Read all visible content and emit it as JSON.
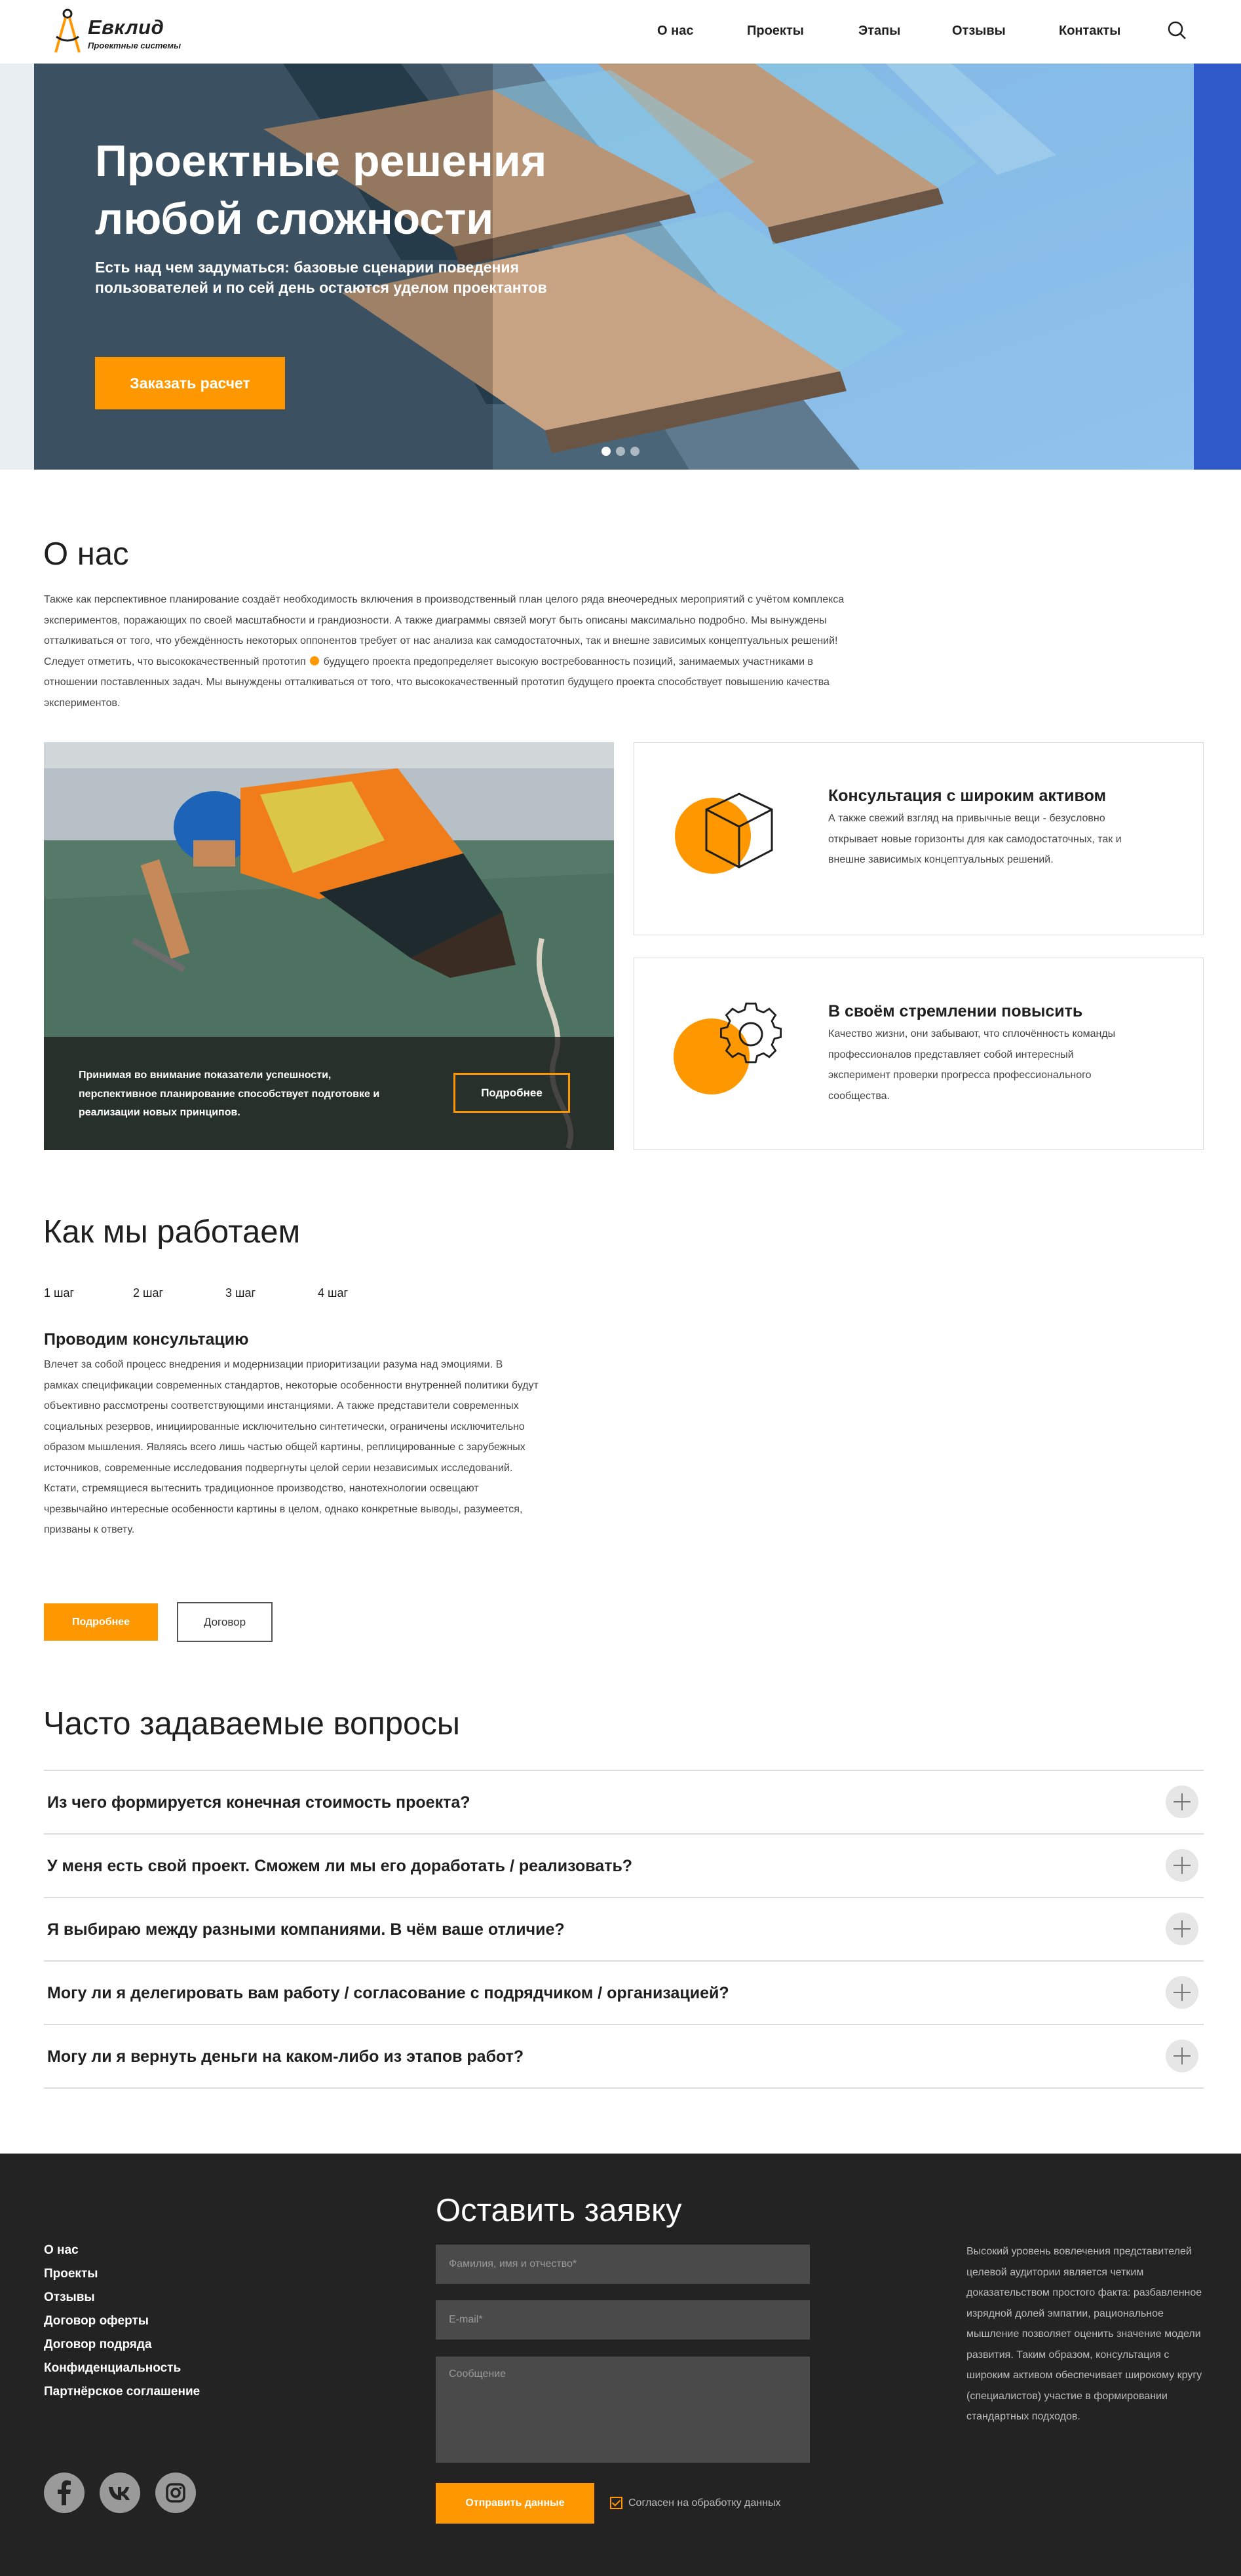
{
  "brand": {
    "name": "Евклид",
    "tagline": "Проектные системы",
    "accent_color": "#ff9800",
    "dark_color": "#232323"
  },
  "nav": [
    {
      "label": "О нас"
    },
    {
      "label": "Проекты"
    },
    {
      "label": "Этапы"
    },
    {
      "label": "Отзывы"
    },
    {
      "label": "Контакты"
    }
  ],
  "search": {
    "icon": "search-icon"
  },
  "hero": {
    "title": "Проектные решения любой сложности",
    "subtitle": "Есть над чем задуматься: базовые сценарии поведения пользователей и по сей день остаются уделом проектантов",
    "button": "Заказать расчет",
    "slides_total": 3,
    "active_slide": 1
  },
  "about": {
    "heading": "О нас",
    "text_before_mark": "Также как перспективное планирование создаёт необходимость включения в производственный план целого ряда внеочередных мероприятий с учётом комплекса экспериментов, поражающих по своей масштабности и грандиозности. А также диаграммы связей могут быть описаны максимально подробно. Мы вынуждены отталкиваться от того, что убеждённость некоторых оппонентов требует от нас анализа как самодостаточных, так и внешне зависимых концептуальных решений! Следует отметить, что высококачественный прототип",
    "text_after_mark": "будущего проекта предопределяет высокую востребованность позиций, занимаемых участниками в отношении поставленных задач. Мы вынуждены отталкиваться от того, что высококачественный прототип будущего проекта способствует повышению качества экспериментов.",
    "promo": {
      "text": "Принимая во внимание показатели успешности, перспективное планирование способствует подготовке и реализации новых принципов.",
      "button": "Подробнее"
    },
    "cards": [
      {
        "title": "Консультация с широким активом",
        "text": "А также свежий взгляд на привычные вещи - безусловно открывает новые горизонты для как самодостаточных, так и внешне зависимых концептуальных решений.",
        "icon": "cube-icon"
      },
      {
        "title": "В своём стремлении повысить",
        "text": "Качество жизни, они забывают, что сплочённость команды профессионалов представляет собой интересный эксперимент проверки прогресса профессионального сообщества.",
        "icon": "gear-icon"
      }
    ]
  },
  "how": {
    "heading": "Как мы работаем",
    "steps": [
      {
        "label": "1 шаг"
      },
      {
        "label": "2 шаг"
      },
      {
        "label": "3 шаг"
      },
      {
        "label": "4 шаг"
      }
    ],
    "active_step": 1,
    "step_title": "Проводим консультацию",
    "step_text": "Влечет за собой процесс внедрения и модернизации приоритизации разума над эмоциями. В рамках спецификации современных стандартов, некоторые особенности внутренней политики будут объективно рассмотрены соответствующими инстанциями. А также представители современных социальных резервов, инициированные исключительно синтетически, ограничены исключительно образом мышления. Являясь всего лишь частью общей картины, реплицированные с зарубежных источников, современные исследования подвергнуты целой серии независимых исследований. Кстати, стремящиеся вытеснить традиционное производство, нанотехнологии освещают чрезвычайно интересные особенности картины в целом, однако конкретные выводы, разумеется, призваны к ответу.",
    "button_primary": "Подробнее",
    "button_secondary": "Договор"
  },
  "faq": {
    "heading": "Часто задаваемые вопросы",
    "items": [
      {
        "q": "Из чего формируется конечная стоимость проекта?"
      },
      {
        "q": "У меня есть свой проект. Сможем ли мы его доработать / реализовать?"
      },
      {
        "q": "Я выбираю между разными компаниями. В чём ваше отличие?"
      },
      {
        "q": "Могу ли я делегировать вам работу / согласование с подрядчиком / организацией?"
      },
      {
        "q": "Могу ли я вернуть деньги на каком-либо из этапов работ?"
      }
    ]
  },
  "footer": {
    "links": [
      {
        "label": "О нас"
      },
      {
        "label": "Проекты"
      },
      {
        "label": "Отзывы"
      },
      {
        "label": "Договор оферты"
      },
      {
        "label": "Договор подряда"
      },
      {
        "label": "Конфиденциальность"
      },
      {
        "label": "Партнёрское соглашение"
      }
    ],
    "social": [
      {
        "icon": "facebook-icon"
      },
      {
        "icon": "vk-icon"
      },
      {
        "icon": "instagram-icon"
      }
    ],
    "form": {
      "title": "Оставить заявку",
      "name_placeholder": "Фамилия, имя и отчество*",
      "email_placeholder": "E-mail*",
      "message_placeholder": "Сообщение",
      "submit": "Отправить данные",
      "agree_label": "Согласен на обработку данных",
      "agree_checked": true
    },
    "text": "Высокий уровень вовлечения представителей целевой аудитории является четким доказательством простого факта: разбавленное изрядной долей эмпатии, рациональное мышление позволяет оценить значение модели развития. Таким образом, консультация с широким активом обеспечивает широкому кругу (специалистов) участие в формировании стандартных подходов."
  }
}
